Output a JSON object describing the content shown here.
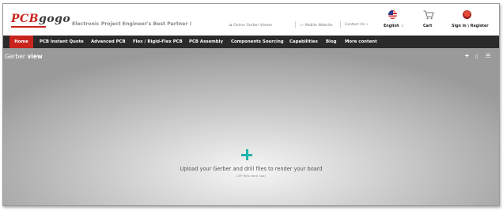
{
  "header": {
    "logo_main": "PCB",
    "logo_accent": "gogo",
    "tagline": "Electronic Project Engineer's Best Partner !",
    "links": {
      "gerber_viewer": "Online Gerber Viewer",
      "mobile": "Mobile Website",
      "contact": "Contact Us"
    },
    "language": "English",
    "cart": "Cart",
    "signin": "Sign in \\ Register"
  },
  "nav": {
    "items": [
      {
        "label": "Home"
      },
      {
        "label": "PCB Instant Quote"
      },
      {
        "label": "Advanced PCB"
      },
      {
        "label": "Flex / Rigid-Flex PCB"
      },
      {
        "label": "PCB Assembly"
      },
      {
        "label": "Components Sourcing"
      },
      {
        "label": "Capabilities"
      },
      {
        "label": "Blog"
      },
      {
        "label": "More content"
      }
    ]
  },
  "viewer": {
    "title_prefix": "Gerber",
    "title_bold": "view",
    "upload_text": "Upload your Gerber and drill files to render your board",
    "upload_sub": "(ZIP files work, too)"
  },
  "icons": {
    "contact_caret": "chevron-down-icon",
    "language_flag": "us-flag-icon",
    "cart": "cart-icon",
    "upload": "plus-icon"
  },
  "colors": {
    "brand_red": "#c8241d",
    "nav_bg": "#2a2a2a",
    "upload_accent": "#1fb5ac"
  }
}
